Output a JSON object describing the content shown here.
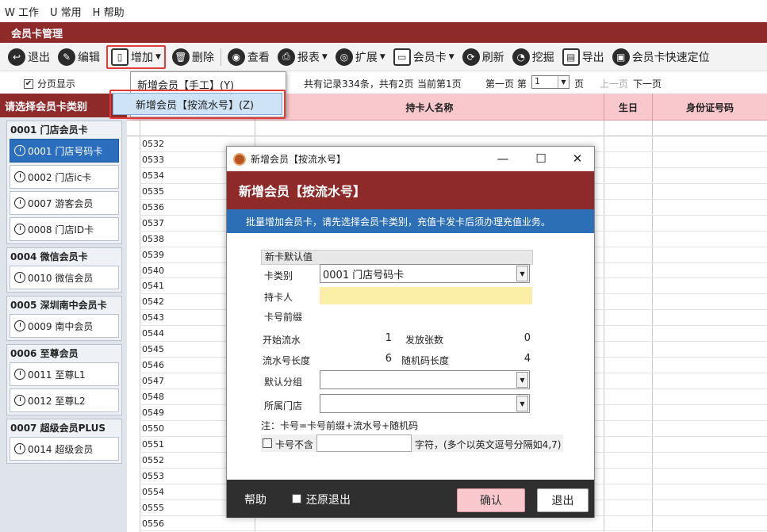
{
  "menubar": {
    "items": [
      "W 工作",
      "U 常用",
      "H 帮助"
    ]
  },
  "window_title": "会员卡管理",
  "toolbar": {
    "exit": "退出",
    "edit": "编辑",
    "add": "增加",
    "delete": "删除",
    "view": "查看",
    "report": "报表",
    "extend": "扩展",
    "card": "会员卡",
    "refresh": "刷新",
    "mine": "挖掘",
    "export": "导出",
    "quick_locate": "会员卡快速定位"
  },
  "pager": {
    "paging_label": "分页显示",
    "records": "共有记录334条，共有2页",
    "current": "当前第1页",
    "first_page": "第一页 第",
    "page_value": "1",
    "page_unit": "页",
    "prev": "上一页",
    "next": "下一页"
  },
  "add_menu": {
    "manual": "新增会员【手工】(Y)",
    "by_serial": "新增会员【按流水号】(Z)"
  },
  "sidebar": {
    "title": "请选择会员卡类别",
    "groups": [
      {
        "title": "0001 门店会员卡",
        "items": [
          "0001 门店号码卡",
          "0002 门店ic卡",
          "0007 游客会员",
          "0008 门店ID卡"
        ]
      },
      {
        "title": "0004 微信会员卡",
        "items": [
          "0010 微信会员"
        ]
      },
      {
        "title": "0005 深圳南中会员卡",
        "items": [
          "0009 南中会员"
        ]
      },
      {
        "title": "0006 至尊会员",
        "items": [
          "0011 至尊L1",
          "0012 至尊L2"
        ]
      },
      {
        "title": "0007 超级会员PLUS",
        "items": [
          "0014 超级会员"
        ]
      }
    ]
  },
  "grid": {
    "columns": [
      "持卡人名称",
      "生日",
      "身份证号码"
    ],
    "rows": [
      "0532",
      "0533",
      "0534",
      "0535",
      "0536",
      "0537",
      "0538",
      "0539",
      "0540",
      "0541",
      "0542",
      "0543",
      "0544",
      "0545",
      "0546",
      "0547",
      "0548",
      "0549",
      "0550",
      "0551",
      "0552",
      "0553",
      "0554",
      "0555",
      "0556"
    ]
  },
  "dialog": {
    "title": "新增会员【按流水号】",
    "banner": "新增会员【按流水号】",
    "info": "批量增加会员卡，请先选择会员卡类别，充值卡发卡后须办理充值业务。",
    "section": "新卡默认值",
    "card_type_label": "卡类别",
    "card_type_value": "0001 门店号码卡",
    "holder_label": "持卡人",
    "prefix_label": "卡号前缀",
    "start_serial_label": "开始流水",
    "start_serial_value": "1",
    "issue_count_label": "发放张数",
    "issue_count_value": "0",
    "serial_len_label": "流水号长度",
    "serial_len_value": "6",
    "random_len_label": "随机码长度",
    "random_len_value": "4",
    "group_label": "默认分组",
    "store_label": "所属门店",
    "note": "注：卡号=卡号前缀+流水号+随机码",
    "exclude_label": "卡号不含",
    "exclude_suffix": "字符，(多个以英文逗号分隔如4,7)",
    "help": "帮助",
    "restore_exit": "还原退出",
    "ok": "确认",
    "exit": "退出"
  },
  "colors": {
    "brand": "#8e2a2a",
    "info": "#2c6fb7",
    "header": "#f8c8cc",
    "highlight": "#e23b3b"
  }
}
